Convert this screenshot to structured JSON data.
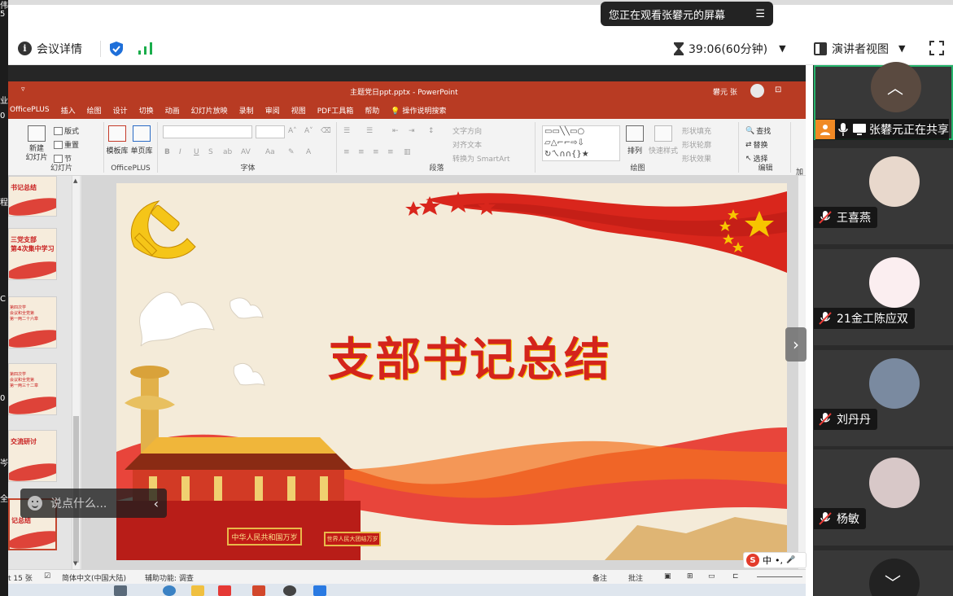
{
  "left_strip": {
    "chars": [
      "伟",
      "5",
      "业",
      "0",
      "程",
      "C",
      "0",
      "岑",
      "全"
    ]
  },
  "share_banner": {
    "text": "您正在观看张礬元的屏幕",
    "menu_icon": "list-icon"
  },
  "meeting_bar": {
    "info_label": "会议详情",
    "timer": "39:06(60分钟)",
    "presenter_view": "演讲者视图",
    "colors": {
      "shield": "#1e6fd9",
      "signal": "#1aad4b"
    }
  },
  "ppt": {
    "quick_access": "▿",
    "doc_title": "主题党日ppt.pptx - PowerPoint",
    "user": "礬元 张",
    "window_ctrl": "⊡",
    "tabs": [
      "OfficePLUS",
      "插入",
      "绘图",
      "设计",
      "切换",
      "动画",
      "幻灯片放映",
      "录制",
      "审阅",
      "视图",
      "PDF工具箱",
      "帮助",
      "💡 操作说明搜索"
    ],
    "ribbon": {
      "slides": {
        "new": "新建\n幻灯片",
        "layout": "版式",
        "reset": "重置",
        "section": "节",
        "label": "幻灯片"
      },
      "officeplus": {
        "template": "模板库",
        "gallery": "单页库",
        "label": "OfficePLUS"
      },
      "font": {
        "bold": "B",
        "italic": "I",
        "underline": "U",
        "shadow": "S",
        "label": "字体"
      },
      "paragraph": {
        "dir": "文字方向",
        "align": "对齐文本",
        "smartart": "转换为 SmartArt",
        "label": "段落"
      },
      "drawing": {
        "arrange": "排列",
        "quick_style": "快速样式",
        "fill": "形状填充",
        "outline": "形状轮廓",
        "effect": "形状效果",
        "label": "绘图"
      },
      "editing": {
        "find": "查找",
        "replace": "替换",
        "select": "选择",
        "label": "编辑",
        "more": "加"
      }
    },
    "thumbnails": [
      {
        "text": "书记总结",
        "small": ""
      },
      {
        "text": "三党支部\n第4次集中学习",
        "small": ""
      },
      {
        "text": "",
        "small": "第四次学\n会议和全党第\n第一两二十六章"
      },
      {
        "text": "",
        "small": "第四次学\n会议和全党第\n第一两三十二章"
      },
      {
        "text": "交流研讨",
        "small": ""
      },
      {
        "text": "记总结",
        "small": ""
      }
    ],
    "comment_placeholder": "说点什么...",
    "comment_collapse": "‹",
    "slide": {
      "title": "支部书记总结",
      "gate_sign": "中华人民共和国万岁",
      "gate_sign2": "世界人民大团结万岁",
      "colors": {
        "title": "#d4241c",
        "flag": "#d9261c",
        "star": "#f7c400",
        "bg": "#f4ebd9"
      }
    },
    "next_arrow": "›",
    "status": {
      "slide_count": "t 15 张",
      "language": "简体中文(中国大陆)",
      "accessibility": "辅助功能: 调查",
      "notes": "备注",
      "comments": "批注"
    },
    "ime": {
      "brand": "S",
      "mode": "中",
      "punct": "•,",
      "mic": "🎤"
    }
  },
  "participants": {
    "presenter_label": "张礬元正在共享",
    "people": [
      "王喜燕",
      "21金工陈应双",
      "刘丹丹",
      "杨敏"
    ],
    "colors": {
      "active_border": "#24b36b",
      "muted": "#e53935",
      "presenter_icon": "#f08a24"
    }
  }
}
